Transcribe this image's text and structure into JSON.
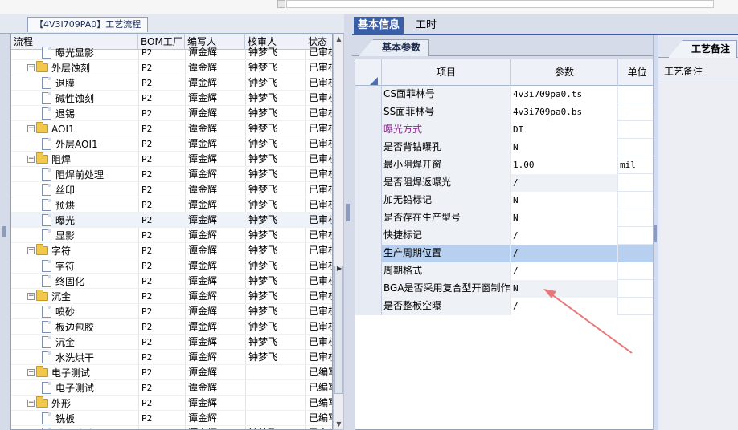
{
  "left_panel": {
    "tab_title": "【4V3I709PA0】工艺流程",
    "columns": [
      "流程",
      "BOM工厂",
      "编写人",
      "核审人",
      "状态"
    ],
    "rows": [
      {
        "name": "曝光显影",
        "type": "doc",
        "level": 2,
        "bom": "P2",
        "writer": "谭金辉",
        "reviewer": "钟梦飞",
        "status": "已审核"
      },
      {
        "name": "外层蚀刻",
        "type": "folder",
        "level": 1,
        "bom": "P2",
        "writer": "谭金辉",
        "reviewer": "钟梦飞",
        "status": "已审核"
      },
      {
        "name": "退膜",
        "type": "doc",
        "level": 2,
        "bom": "P2",
        "writer": "谭金辉",
        "reviewer": "钟梦飞",
        "status": "已审核"
      },
      {
        "name": "碱性蚀刻",
        "type": "doc",
        "level": 2,
        "bom": "P2",
        "writer": "谭金辉",
        "reviewer": "钟梦飞",
        "status": "已审核"
      },
      {
        "name": "退锡",
        "type": "doc",
        "level": 2,
        "bom": "P2",
        "writer": "谭金辉",
        "reviewer": "钟梦飞",
        "status": "已审核"
      },
      {
        "name": "AOI1",
        "type": "folder",
        "level": 1,
        "bom": "P2",
        "writer": "谭金辉",
        "reviewer": "钟梦飞",
        "status": "已审核"
      },
      {
        "name": "外层AOI1",
        "type": "doc",
        "level": 2,
        "bom": "P2",
        "writer": "谭金辉",
        "reviewer": "钟梦飞",
        "status": "已审核"
      },
      {
        "name": "阻焊",
        "type": "folder",
        "level": 1,
        "bom": "P2",
        "writer": "谭金辉",
        "reviewer": "钟梦飞",
        "status": "已审核"
      },
      {
        "name": "阻焊前处理",
        "type": "doc",
        "level": 2,
        "bom": "P2",
        "writer": "谭金辉",
        "reviewer": "钟梦飞",
        "status": "已审核"
      },
      {
        "name": "丝印",
        "type": "doc",
        "level": 2,
        "bom": "P2",
        "writer": "谭金辉",
        "reviewer": "钟梦飞",
        "status": "已审核"
      },
      {
        "name": "预烘",
        "type": "doc",
        "level": 2,
        "bom": "P2",
        "writer": "谭金辉",
        "reviewer": "钟梦飞",
        "status": "已审核"
      },
      {
        "name": "曝光",
        "type": "doc",
        "level": 2,
        "bom": "P2",
        "writer": "谭金辉",
        "reviewer": "钟梦飞",
        "status": "已审核",
        "selected": true
      },
      {
        "name": "显影",
        "type": "doc",
        "level": 2,
        "bom": "P2",
        "writer": "谭金辉",
        "reviewer": "钟梦飞",
        "status": "已审核"
      },
      {
        "name": "字符",
        "type": "folder",
        "level": 1,
        "bom": "P2",
        "writer": "谭金辉",
        "reviewer": "钟梦飞",
        "status": "已审核"
      },
      {
        "name": "字符",
        "type": "doc",
        "level": 2,
        "bom": "P2",
        "writer": "谭金辉",
        "reviewer": "钟梦飞",
        "status": "已审核"
      },
      {
        "name": "终固化",
        "type": "doc",
        "level": 2,
        "bom": "P2",
        "writer": "谭金辉",
        "reviewer": "钟梦飞",
        "status": "已审核"
      },
      {
        "name": "沉金",
        "type": "folder",
        "level": 1,
        "bom": "P2",
        "writer": "谭金辉",
        "reviewer": "钟梦飞",
        "status": "已审核"
      },
      {
        "name": "喷砂",
        "type": "doc",
        "level": 2,
        "bom": "P2",
        "writer": "谭金辉",
        "reviewer": "钟梦飞",
        "status": "已审核"
      },
      {
        "name": "板边包胶",
        "type": "doc",
        "level": 2,
        "bom": "P2",
        "writer": "谭金辉",
        "reviewer": "钟梦飞",
        "status": "已审核"
      },
      {
        "name": "沉金",
        "type": "doc",
        "level": 2,
        "bom": "P2",
        "writer": "谭金辉",
        "reviewer": "钟梦飞",
        "status": "已审核"
      },
      {
        "name": "水洗烘干",
        "type": "doc",
        "level": 2,
        "bom": "P2",
        "writer": "谭金辉",
        "reviewer": "钟梦飞",
        "status": "已审核"
      },
      {
        "name": "电子测试",
        "type": "folder",
        "level": 1,
        "bom": "P2",
        "writer": "谭金辉",
        "reviewer": "",
        "status": "已编写"
      },
      {
        "name": "电子测试",
        "type": "doc",
        "level": 2,
        "bom": "P2",
        "writer": "谭金辉",
        "reviewer": "",
        "status": "已编写"
      },
      {
        "name": "外形",
        "type": "folder",
        "level": 1,
        "bom": "P2",
        "writer": "谭金辉",
        "reviewer": "",
        "status": "已编写"
      },
      {
        "name": "铣板",
        "type": "doc",
        "level": 2,
        "bom": "P2",
        "writer": "谭金辉",
        "reviewer": "",
        "status": "已编写"
      },
      {
        "name": "成品清洗",
        "type": "doc",
        "level": 2,
        "bom": "P2",
        "writer": "谭金辉",
        "reviewer": "钟梦飞",
        "status": "已审核"
      }
    ]
  },
  "right_panel": {
    "tabs": [
      "基本信息",
      "工时"
    ],
    "subtab": "基本参数",
    "columns": [
      "项目",
      "参数",
      "单位"
    ],
    "rows": [
      {
        "item": "CS面菲林号",
        "value": "4v3i709pa0.ts",
        "unit": "",
        "value_white": true
      },
      {
        "item": "SS面菲林号",
        "value": "4v3i709pa0.bs",
        "unit": "",
        "value_white": true
      },
      {
        "item": "曝光方式",
        "value": "DI",
        "unit": "",
        "value_white": true,
        "purple": true
      },
      {
        "item": "是否背钻曝孔",
        "value": "N",
        "unit": "",
        "value_white": true
      },
      {
        "item": "最小阻焊开窗",
        "value": "1.00",
        "unit": "mil",
        "value_white": true
      },
      {
        "item": "是否阻焊返曝光",
        "value": "/",
        "unit": "",
        "value_white": false
      },
      {
        "item": "加无铅标记",
        "value": "N",
        "unit": "",
        "value_white": true
      },
      {
        "item": "是否存在生产型号",
        "value": "N",
        "unit": "",
        "value_white": true
      },
      {
        "item": "快捷标记",
        "value": "/",
        "unit": "",
        "value_white": true
      },
      {
        "item": "生产周期位置",
        "value": "/",
        "unit": "",
        "highlight": true
      },
      {
        "item": "周期格式",
        "value": "/",
        "unit": "",
        "value_white": true
      },
      {
        "item": "BGA是否采用复合型开窗制作",
        "value": "N",
        "unit": "",
        "value_white": false
      },
      {
        "item": "是否整板空曝",
        "value": "/",
        "unit": "",
        "value_white": true
      }
    ]
  },
  "far_right_panel": {
    "tab": "工艺备注",
    "label": "工艺备注"
  },
  "colors": {
    "tab_active_bg": "#3b5ea8",
    "highlight_row": "#b7d0ef",
    "arrow": "#e8777a",
    "purple_item": "#8a2a8f"
  }
}
